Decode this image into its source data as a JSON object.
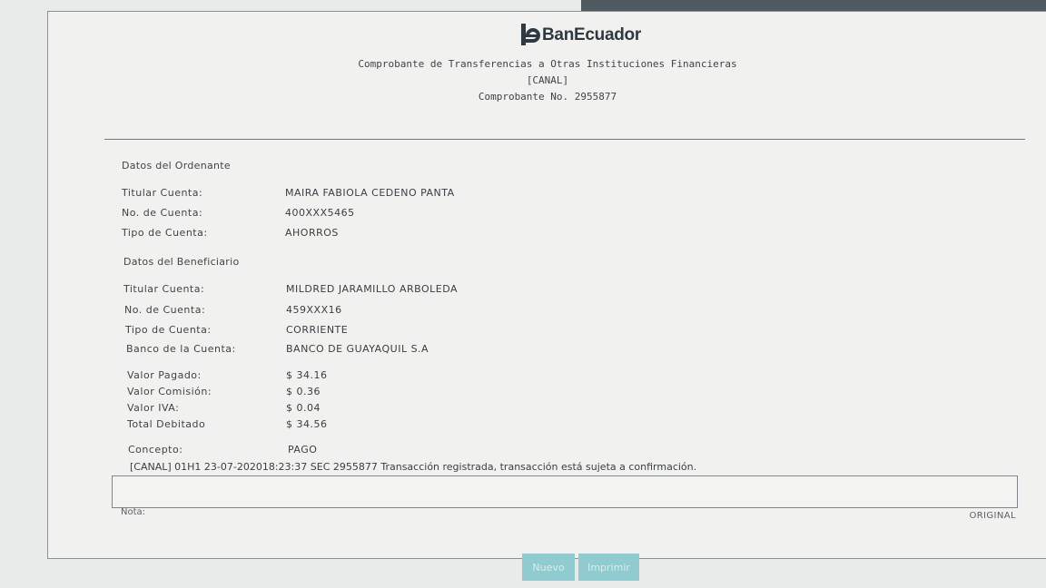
{
  "brand": {
    "name": "BanEcuador",
    "accent_color": "#2f3940",
    "logo_icon": "banecuador-e-icon"
  },
  "header": {
    "title": "Comprobante de Transferencias a Otras Instituciones Financieras",
    "channel": "[CANAL]",
    "receipt": "Comprobante No. 2955877"
  },
  "ordenante": {
    "section_title": "Datos del Ordenante",
    "rows": [
      {
        "label": "Titular Cuenta:",
        "value": "MAIRA FABIOLA CEDENO PANTA"
      },
      {
        "label": "No. de Cuenta:",
        "value": "400XXX5465"
      },
      {
        "label": "Tipo de Cuenta:",
        "value": "AHORROS"
      }
    ]
  },
  "beneficiario": {
    "section_title": "Datos del Beneficiario",
    "rows": [
      {
        "label": "Titular Cuenta:",
        "value": "MILDRED JARAMILLO ARBOLEDA"
      },
      {
        "label": "No. de Cuenta:",
        "value": "459XXX16"
      },
      {
        "label": "Tipo de Cuenta:",
        "value": "CORRIENTE"
      },
      {
        "label": "Banco de la Cuenta:",
        "value": "BANCO DE GUAYAQUIL S.A"
      }
    ]
  },
  "valores": {
    "rows": [
      {
        "label": "Valor Pagado:",
        "value": "$ 34.16"
      },
      {
        "label": "Valor Comisión:",
        "value": "$ 0.36"
      },
      {
        "label": "Valor IVA:",
        "value": "$ 0.04"
      },
      {
        "label": "Total Debitado",
        "value": "$ 34.56"
      }
    ]
  },
  "concepto": {
    "label": "Concepto:",
    "value": "PAGO"
  },
  "status": "[CANAL] 01H1 23-07-202018:23:37 SEC 2955877 Transacción registrada, transacción está sujeta a confirmación.",
  "nota": {
    "label": "Nota:"
  },
  "copy_label": "ORIGINAL",
  "buttons": {
    "nuevo": "Nuevo",
    "imprimir": "Imprimir"
  }
}
